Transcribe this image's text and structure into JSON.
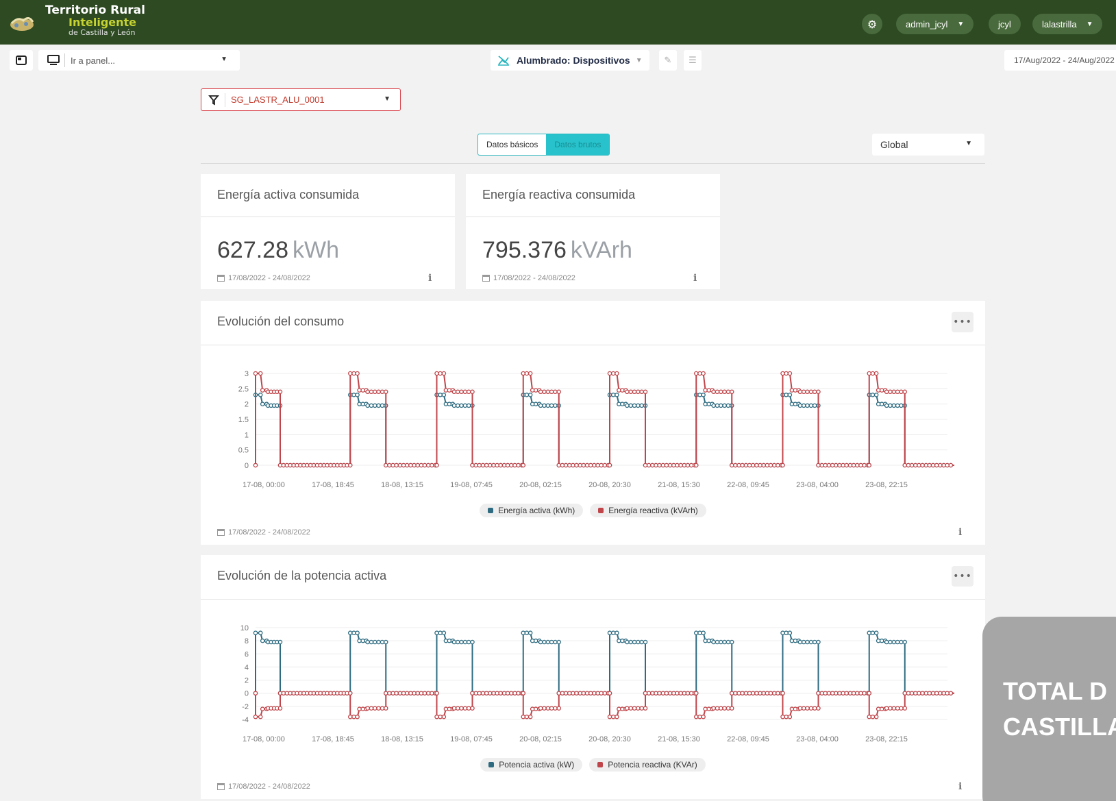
{
  "header": {
    "brand_line1": "Territorio Rural",
    "brand_line2": "Inteligente",
    "brand_line3": "de Castilla y León",
    "user_menu": "admin_jcyl",
    "tenant": "jcyl",
    "site_menu": "lalastrilla",
    "colors": {
      "topbar": "#2d4a22",
      "brand_accent": "#c6d330"
    }
  },
  "subbar": {
    "panel_placeholder": "Ir a panel...",
    "dashboard_title": "Alumbrado: Dispositivos",
    "date_range": "17/Aug/2022 - 24/Aug/2022"
  },
  "filter": {
    "device": "SG_LASTR_ALU_0001"
  },
  "view_toggle": {
    "basic": "Datos básicos",
    "raw": "Datos brutos"
  },
  "scope_select": {
    "value": "Global"
  },
  "kpis": [
    {
      "title": "Energía activa consumida",
      "value": "627.28",
      "unit": "kWh",
      "date": "17/08/2022 - 24/08/2022"
    },
    {
      "title": "Energía reactiva consumida",
      "value": "795.376",
      "unit": "kVArh",
      "date": "17/08/2022 - 24/08/2022"
    }
  ],
  "charts": {
    "energy": {
      "title": "Evolución del consumo",
      "date": "17/08/2022 - 24/08/2022",
      "legend": [
        "Energía activa (kWh)",
        "Energía reactiva (kVArh)"
      ]
    },
    "power": {
      "title": "Evolución de la potencia activa",
      "date": "17/08/2022 - 24/08/2022",
      "legend": [
        "Potencia activa (kW)",
        "Potencia reactiva (KVAr)"
      ]
    }
  },
  "overlay": {
    "line1": "TOTAL D",
    "line2": "CASTILLA"
  },
  "chart_data": [
    {
      "type": "line",
      "title": "Evolución del consumo",
      "x_tick_labels": [
        "17-08, 00:00",
        "17-08, 18:45",
        "18-08, 13:15",
        "19-08, 07:45",
        "20-08, 02:15",
        "20-08, 20:30",
        "21-08, 15:30",
        "22-08, 09:45",
        "23-08, 04:00",
        "23-08, 22:15"
      ],
      "y_ticks": [
        0,
        0.5,
        1,
        1.5,
        2,
        2.5,
        3
      ],
      "ylim": [
        0,
        3
      ],
      "colors": {
        "Energía activa (kWh)": "#2e6b80",
        "Energía reactiva (kVArh)": "#c0454a"
      },
      "series": [
        {
          "name": "Energía activa (kWh)",
          "on_levels": [
            2.3,
            2.0,
            1.95
          ],
          "off_level": 0
        },
        {
          "name": "Energía reactiva (kVArh)",
          "on_levels": [
            3.0,
            2.45,
            2.4
          ],
          "off_level": 0
        }
      ],
      "cycles": 8
    },
    {
      "type": "line",
      "title": "Evolución de la potencia activa",
      "x_tick_labels": [
        "17-08, 00:00",
        "17-08, 18:45",
        "18-08, 13:15",
        "19-08, 07:45",
        "20-08, 02:15",
        "20-08, 20:30",
        "21-08, 15:30",
        "22-08, 09:45",
        "23-08, 04:00",
        "23-08, 22:15"
      ],
      "y_ticks": [
        10,
        8,
        6,
        4,
        2,
        0,
        -2,
        -4
      ],
      "ylim": [
        -4,
        10
      ],
      "colors": {
        "Potencia activa (kW)": "#2e6b80",
        "Potencia reactiva (KVAr)": "#c0454a"
      },
      "series": [
        {
          "name": "Potencia activa (kW)",
          "on_levels": [
            9.2,
            8.0,
            7.8
          ],
          "off_level": 0
        },
        {
          "name": "Potencia reactiva (KVAr)",
          "on_levels": [
            -3.6,
            -2.4,
            -2.3
          ],
          "off_level": 0
        }
      ],
      "cycles": 8
    }
  ]
}
